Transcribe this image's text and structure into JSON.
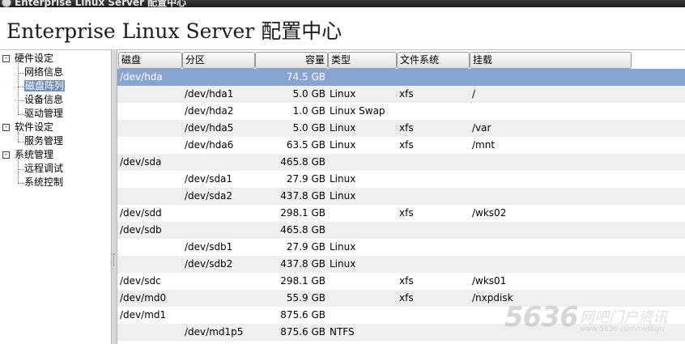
{
  "window": {
    "title": "Enterprise Linux Server 配置中心"
  },
  "header": {
    "title": "Enterprise Linux Server 配置中心"
  },
  "tree": [
    {
      "label": "硬件设定",
      "type": "group",
      "expanded": true,
      "icon": "collapse-icon"
    },
    {
      "label": "网络信息",
      "type": "leaf",
      "selected": false
    },
    {
      "label": "磁盘阵列",
      "type": "leaf",
      "selected": true
    },
    {
      "label": "设备信息",
      "type": "leaf",
      "selected": false
    },
    {
      "label": "驱动管理",
      "type": "leaf",
      "selected": false
    },
    {
      "label": "软件设定",
      "type": "group",
      "expanded": true,
      "icon": "collapse-icon"
    },
    {
      "label": "服务管理",
      "type": "leaf",
      "selected": false
    },
    {
      "label": "系统管理",
      "type": "group",
      "expanded": true,
      "icon": "collapse-icon"
    },
    {
      "label": "远程调试",
      "type": "leaf",
      "selected": false
    },
    {
      "label": "系统控制",
      "type": "leaf",
      "selected": false
    }
  ],
  "table": {
    "columns": [
      "磁盘",
      "分区",
      "容量",
      "类型",
      "文件系统",
      "挂载"
    ],
    "rows": [
      {
        "disk": "/dev/hda",
        "part": "",
        "size": "74.5 GB",
        "type": "",
        "fs": "",
        "mount": "",
        "selected": true
      },
      {
        "disk": "",
        "part": "/dev/hda1",
        "size": "5.0 GB",
        "type": "Linux",
        "fs": "xfs",
        "mount": "/"
      },
      {
        "disk": "",
        "part": "/dev/hda2",
        "size": "1.0 GB",
        "type": "Linux Swap",
        "fs": "",
        "mount": ""
      },
      {
        "disk": "",
        "part": "/dev/hda5",
        "size": "5.0 GB",
        "type": "Linux",
        "fs": "xfs",
        "mount": "/var"
      },
      {
        "disk": "",
        "part": "/dev/hda6",
        "size": "63.5 GB",
        "type": "Linux",
        "fs": "xfs",
        "mount": "/mnt"
      },
      {
        "disk": "/dev/sda",
        "part": "",
        "size": "465.8 GB",
        "type": "",
        "fs": "",
        "mount": ""
      },
      {
        "disk": "",
        "part": "/dev/sda1",
        "size": "27.9 GB",
        "type": "Linux",
        "fs": "",
        "mount": ""
      },
      {
        "disk": "",
        "part": "/dev/sda2",
        "size": "437.8 GB",
        "type": "Linux",
        "fs": "",
        "mount": ""
      },
      {
        "disk": "/dev/sdd",
        "part": "",
        "size": "298.1 GB",
        "type": "",
        "fs": "xfs",
        "mount": "/wks02"
      },
      {
        "disk": "/dev/sdb",
        "part": "",
        "size": "465.8 GB",
        "type": "",
        "fs": "",
        "mount": ""
      },
      {
        "disk": "",
        "part": "/dev/sdb1",
        "size": "27.9 GB",
        "type": "Linux",
        "fs": "",
        "mount": ""
      },
      {
        "disk": "",
        "part": "/dev/sdb2",
        "size": "437.8 GB",
        "type": "Linux",
        "fs": "",
        "mount": ""
      },
      {
        "disk": "/dev/sdc",
        "part": "",
        "size": "298.1 GB",
        "type": "",
        "fs": "xfs",
        "mount": "/wks01"
      },
      {
        "disk": "/dev/md0",
        "part": "",
        "size": "55.9 GB",
        "type": "",
        "fs": "xfs",
        "mount": "/nxpdisk"
      },
      {
        "disk": "/dev/md1",
        "part": "",
        "size": "875.6 GB",
        "type": "",
        "fs": "",
        "mount": ""
      },
      {
        "disk": "",
        "part": "/dev/md1p5",
        "size": "875.6 GB",
        "type": "NTFS",
        "fs": "",
        "mount": ""
      }
    ]
  },
  "watermark": {
    "number": "5636",
    "text": "网吧门户资讯",
    "url": "www.5636.com/netbar/"
  },
  "colors": {
    "selection": "#86a5d1",
    "tree_selection": "#6b8fbf",
    "alt_row": "#efefef"
  }
}
